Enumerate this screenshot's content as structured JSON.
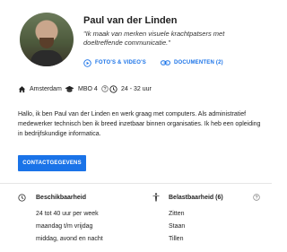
{
  "profile": {
    "name": "Paul van der Linden",
    "tagline": "\"Ik maak van merken visuele krachtpatsers met doeltreffende communicatie.\"",
    "photos_label": "FOTO'S & VIDEO'S",
    "documents_label": "DOCUMENTEN (2)"
  },
  "meta": {
    "location": "Amsterdam",
    "education": "MBO 4",
    "hours": "24 - 32 uur"
  },
  "description": "Hallo, ik ben Paul van der Linden en werk graag met computers. Als administratief medewerker technisch ben ik breed inzetbaar binnen organisaties. Ik heb een opleiding in bedrijfskundige informatica.",
  "contact_button": "CONTACTGEGEVENS",
  "availability": {
    "title": "Beschikbaarheid",
    "items": [
      "24 tot 40 uur per week",
      "maandag t/m vrijdag",
      "middag, avond en nacht"
    ]
  },
  "workload": {
    "title": "Belastbaarheid (6)",
    "items": [
      "Zitten",
      "Staan",
      "Tillen"
    ]
  },
  "colors": {
    "accent": "#1a73e8"
  },
  "icons": {
    "photos": "play-circle-icon",
    "documents": "link-icon",
    "location": "home-icon",
    "education": "graduation-cap-icon",
    "info": "help-circle-icon",
    "hours": "clock-icon",
    "availability": "clock-icon",
    "workload": "person-icon"
  }
}
